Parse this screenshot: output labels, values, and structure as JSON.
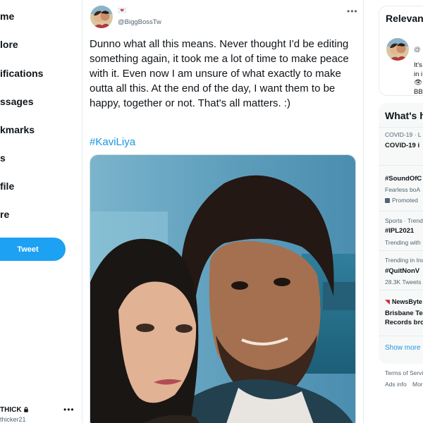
{
  "nav": {
    "items": [
      {
        "label": "me"
      },
      {
        "label": "lore"
      },
      {
        "label": "ifications"
      },
      {
        "label": "ssages"
      },
      {
        "label": "kmarks"
      },
      {
        "label": "s"
      },
      {
        "label": "file"
      },
      {
        "label": "re"
      }
    ],
    "tweet_button": "Tweet",
    "account_name": "THICK",
    "account_handle": "thicker21",
    "account_more": "•••"
  },
  "tweet": {
    "name_emoji": "💌",
    "handle": "@BiggBossTw",
    "more": "•••",
    "text": "Dunno what all this means. Never thought I'd be editing something again, it took me a lot of time to make peace with it. Even now I am unsure of what exactly to make outta all this. At the end of the day, I want them to be happy, together or not. That's all matters. :)",
    "hashtag": "#KaviLiya"
  },
  "sidebar": {
    "relevant": {
      "title": "Relevant",
      "handle_prefix": "@",
      "line1": "It's",
      "line2": "in i",
      "line3_icon": "👁",
      "line4": "BB"
    },
    "trends": {
      "title": "What's h",
      "items": [
        {
          "context": "COVID-19 · L",
          "title": "COVID-19 i"
        },
        {
          "title": "#SoundOfC",
          "desc": "Fearless boA",
          "meta": "Promoted"
        },
        {
          "context": "Sports · Trend",
          "title": "#IPL2021",
          "meta": "Trending with"
        },
        {
          "context": "Trending in Ind",
          "title": "#QuitNonV",
          "meta": "28.3K Tweets"
        },
        {
          "source": "NewsByte",
          "title_line1": "Brisbane Te",
          "title_line2": "Records bro"
        }
      ],
      "show_more": "Show more"
    },
    "footer": {
      "line1": "Terms of Servi",
      "line2_a": "Ads info",
      "line2_b": "More"
    }
  }
}
